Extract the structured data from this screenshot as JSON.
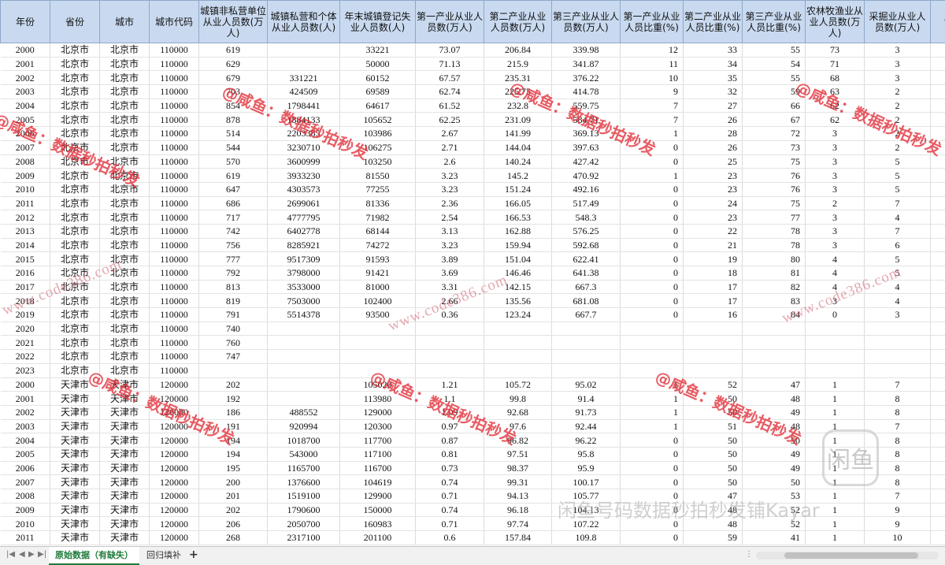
{
  "headers": [
    "年份",
    "省份",
    "城市",
    "城市代码",
    "城镇非私营单位从业人员数(万人)",
    "城镇私营和个体从业人员数(人)",
    "年末城镇登记失业人员数(人)",
    "第一产业从业人员数(万人)",
    "第二产业从业人员数(万人)",
    "第三产业从业人员数(万人)",
    "第一产业从业人员比重(%)",
    "第二产业从业人员比重(%)",
    "第三产业从业人员比重(%)",
    "农林牧渔业从业人员数(万人)",
    "采掘业从业人员数(万人)",
    "制"
  ],
  "rows": [
    [
      "2000",
      "北京市",
      "北京市",
      "110000",
      "619",
      "",
      "33221",
      "73.07",
      "206.84",
      "339.98",
      "12",
      "33",
      "55",
      "73",
      "3",
      ""
    ],
    [
      "2001",
      "北京市",
      "北京市",
      "110000",
      "629",
      "",
      "50000",
      "71.13",
      "215.9",
      "341.87",
      "11",
      "34",
      "54",
      "71",
      "3",
      ""
    ],
    [
      "2002",
      "北京市",
      "北京市",
      "110000",
      "679",
      "331221",
      "60152",
      "67.57",
      "235.31",
      "376.22",
      "10",
      "35",
      "55",
      "68",
      "3",
      ""
    ],
    [
      "2003",
      "北京市",
      "北京市",
      "110000",
      "703",
      "424509",
      "69589",
      "62.74",
      "225.75",
      "414.78",
      "9",
      "32",
      "59",
      "63",
      "2",
      ""
    ],
    [
      "2004",
      "北京市",
      "北京市",
      "110000",
      "854",
      "1798441",
      "64617",
      "61.52",
      "232.8",
      "559.75",
      "7",
      "27",
      "66",
      "62",
      "2",
      ""
    ],
    [
      "2005",
      "北京市",
      "北京市",
      "110000",
      "878",
      "1884133",
      "105652",
      "62.25",
      "231.09",
      "584.71",
      "7",
      "26",
      "67",
      "62",
      "2",
      ""
    ],
    [
      "2006",
      "北京市",
      "北京市",
      "110000",
      "514",
      "2203385",
      "103986",
      "2.67",
      "141.99",
      "369.13",
      "1",
      "28",
      "72",
      "3",
      "2",
      ""
    ],
    [
      "2007",
      "北京市",
      "北京市",
      "110000",
      "544",
      "3230710",
      "106275",
      "2.71",
      "144.04",
      "397.63",
      "0",
      "26",
      "73",
      "3",
      "2",
      ""
    ],
    [
      "2008",
      "北京市",
      "北京市",
      "110000",
      "570",
      "3600999",
      "103250",
      "2.6",
      "140.24",
      "427.42",
      "0",
      "25",
      "75",
      "3",
      "5",
      ""
    ],
    [
      "2009",
      "北京市",
      "北京市",
      "110000",
      "619",
      "3933230",
      "81550",
      "3.23",
      "145.2",
      "470.92",
      "1",
      "23",
      "76",
      "3",
      "5",
      ""
    ],
    [
      "2010",
      "北京市",
      "北京市",
      "110000",
      "647",
      "4303573",
      "77255",
      "3.23",
      "151.24",
      "492.16",
      "0",
      "23",
      "76",
      "3",
      "5",
      ""
    ],
    [
      "2011",
      "北京市",
      "北京市",
      "110000",
      "686",
      "2699061",
      "81336",
      "2.36",
      "166.05",
      "517.49",
      "0",
      "24",
      "75",
      "2",
      "7",
      ""
    ],
    [
      "2012",
      "北京市",
      "北京市",
      "110000",
      "717",
      "4777795",
      "71982",
      "2.54",
      "166.53",
      "548.3",
      "0",
      "23",
      "77",
      "3",
      "4",
      ""
    ],
    [
      "2013",
      "北京市",
      "北京市",
      "110000",
      "742",
      "6402778",
      "68144",
      "3.13",
      "162.88",
      "576.25",
      "0",
      "22",
      "78",
      "3",
      "7",
      ""
    ],
    [
      "2014",
      "北京市",
      "北京市",
      "110000",
      "756",
      "8285921",
      "74272",
      "3.23",
      "159.94",
      "592.68",
      "0",
      "21",
      "78",
      "3",
      "6",
      ""
    ],
    [
      "2015",
      "北京市",
      "北京市",
      "110000",
      "777",
      "9517309",
      "91593",
      "3.89",
      "151.04",
      "622.41",
      "0",
      "19",
      "80",
      "4",
      "5",
      ""
    ],
    [
      "2016",
      "北京市",
      "北京市",
      "110000",
      "792",
      "3798000",
      "91421",
      "3.69",
      "146.46",
      "641.38",
      "0",
      "18",
      "81",
      "4",
      "5",
      ""
    ],
    [
      "2017",
      "北京市",
      "北京市",
      "110000",
      "813",
      "3533000",
      "81000",
      "3.31",
      "142.15",
      "667.3",
      "0",
      "17",
      "82",
      "4",
      "4",
      ""
    ],
    [
      "2018",
      "北京市",
      "北京市",
      "110000",
      "819",
      "7503000",
      "102400",
      "2.66",
      "135.56",
      "681.08",
      "0",
      "17",
      "83",
      "3",
      "4",
      ""
    ],
    [
      "2019",
      "北京市",
      "北京市",
      "110000",
      "791",
      "5514378",
      "93500",
      "0.36",
      "123.24",
      "667.7",
      "0",
      "16",
      "84",
      "0",
      "3",
      ""
    ],
    [
      "2020",
      "北京市",
      "北京市",
      "110000",
      "740",
      "",
      "",
      "",
      "",
      "",
      "",
      "",
      "",
      "",
      "",
      ""
    ],
    [
      "2021",
      "北京市",
      "北京市",
      "110000",
      "760",
      "",
      "",
      "",
      "",
      "",
      "",
      "",
      "",
      "",
      "",
      ""
    ],
    [
      "2022",
      "北京市",
      "北京市",
      "110000",
      "747",
      "",
      "",
      "",
      "",
      "",
      "",
      "",
      "",
      "",
      "",
      ""
    ],
    [
      "2023",
      "北京市",
      "北京市",
      "110000",
      "",
      "",
      "",
      "",
      "",
      "",
      "",
      "",
      "",
      "",
      "",
      ""
    ],
    [
      "2000",
      "天津市",
      "天津市",
      "120000",
      "202",
      "",
      "105020",
      "1.21",
      "105.72",
      "95.02",
      "1",
      "52",
      "47",
      "1",
      "7",
      ""
    ],
    [
      "2001",
      "天津市",
      "天津市",
      "120000",
      "192",
      "",
      "113980",
      "1.1",
      "99.8",
      "91.4",
      "1",
      "50",
      "48",
      "1",
      "8",
      ""
    ],
    [
      "2002",
      "天津市",
      "天津市",
      "120000",
      "186",
      "488552",
      "129000",
      "1.09",
      "92.68",
      "91.73",
      "1",
      "50",
      "49",
      "1",
      "8",
      ""
    ],
    [
      "2003",
      "天津市",
      "天津市",
      "120000",
      "191",
      "920994",
      "120300",
      "0.97",
      "97.6",
      "92.44",
      "1",
      "51",
      "48",
      "1",
      "7",
      ""
    ],
    [
      "2004",
      "天津市",
      "天津市",
      "120000",
      "194",
      "1018700",
      "117700",
      "0.87",
      "96.82",
      "96.22",
      "0",
      "50",
      "50",
      "1",
      "8",
      ""
    ],
    [
      "2005",
      "天津市",
      "天津市",
      "120000",
      "194",
      "543000",
      "117100",
      "0.81",
      "97.51",
      "95.8",
      "0",
      "50",
      "49",
      "1",
      "8",
      ""
    ],
    [
      "2006",
      "天津市",
      "天津市",
      "120000",
      "195",
      "1165700",
      "116700",
      "0.73",
      "98.37",
      "95.9",
      "0",
      "50",
      "49",
      "1",
      "8",
      ""
    ],
    [
      "2007",
      "天津市",
      "天津市",
      "120000",
      "200",
      "1376600",
      "104619",
      "0.74",
      "99.31",
      "100.17",
      "0",
      "50",
      "50",
      "1",
      "8",
      ""
    ],
    [
      "2008",
      "天津市",
      "天津市",
      "120000",
      "201",
      "1519100",
      "129900",
      "0.71",
      "94.13",
      "105.77",
      "0",
      "47",
      "53",
      "1",
      "7",
      ""
    ],
    [
      "2009",
      "天津市",
      "天津市",
      "120000",
      "202",
      "1790600",
      "150000",
      "0.74",
      "96.18",
      "104.13",
      "0",
      "48",
      "52",
      "1",
      "9",
      ""
    ],
    [
      "2010",
      "天津市",
      "天津市",
      "120000",
      "206",
      "2050700",
      "160983",
      "0.71",
      "97.74",
      "107.22",
      "0",
      "48",
      "52",
      "1",
      "9",
      ""
    ],
    [
      "2011",
      "天津市",
      "天津市",
      "120000",
      "268",
      "2317100",
      "201100",
      "0.6",
      "157.84",
      "109.8",
      "0",
      "59",
      "41",
      "1",
      "10",
      ""
    ]
  ],
  "watermarks": {
    "red_text": "@咸鱼：数据秒拍秒发",
    "url_text": "www.code386.com",
    "shop_text": "闲鱼号码数据秒拍秒发铺Kayar",
    "logo_text": "闲鱼"
  },
  "tabs": {
    "nav_first": "|◀",
    "nav_prev": "◀",
    "nav_next": "▶",
    "nav_last": "▶|",
    "active": "原始数据（有缺失）",
    "other": "回归填补",
    "add": "+"
  },
  "colors": {
    "header_bg": "#c9daf0",
    "active_tab": "#1f7a3a",
    "watermark_red": "#e12d37"
  }
}
